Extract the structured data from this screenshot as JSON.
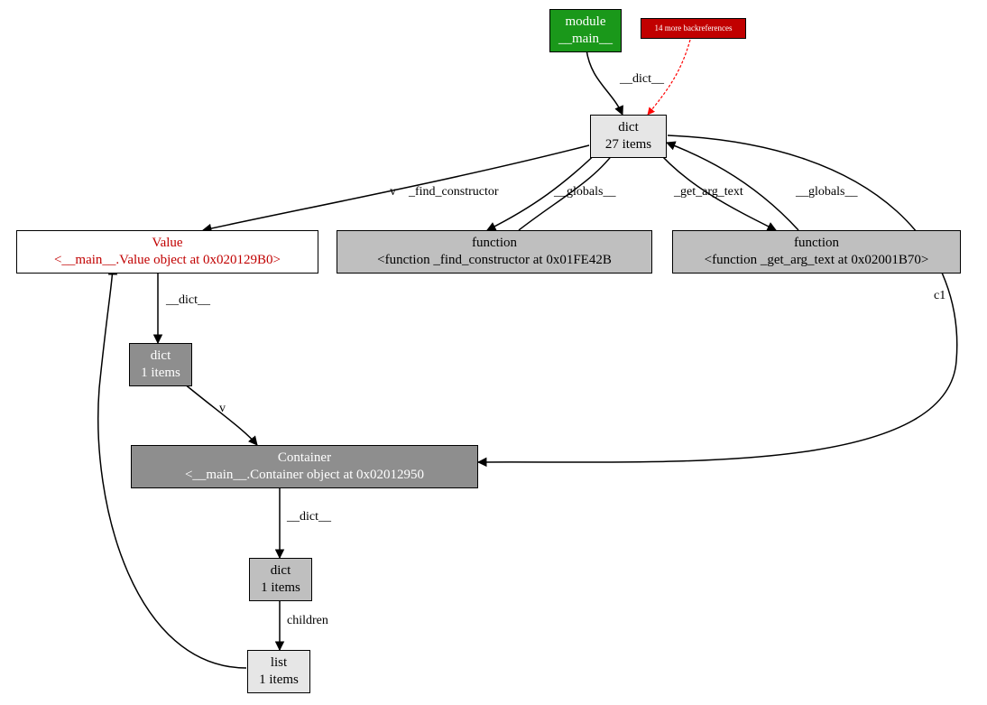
{
  "nodes": {
    "module": {
      "line1": "module",
      "line2": "__main__"
    },
    "backrefs": {
      "line1": "14 more backreferences"
    },
    "dict27": {
      "line1": "dict",
      "line2": "27 items"
    },
    "value": {
      "line1": "Value",
      "line2": "<__main__.Value object at 0x020129B0>"
    },
    "func1": {
      "line1": "function",
      "line2": "<function _find_constructor at 0x01FE42B"
    },
    "func2": {
      "line1": "function",
      "line2": "<function _get_arg_text at 0x02001B70>"
    },
    "dict1a": {
      "line1": "dict",
      "line2": "1 items"
    },
    "container": {
      "line1": "Container",
      "line2": "<__main__.Container object at 0x02012950"
    },
    "dict1b": {
      "line1": "dict",
      "line2": "1 items"
    },
    "list1": {
      "line1": "list",
      "line2": "1 items"
    }
  },
  "edge_labels": {
    "module_dict27": "__dict__",
    "dict27_value": "v",
    "dict27_func1a": "_find_constructor",
    "func1_dict27": "__globals__",
    "dict27_func2a": "_get_arg_text",
    "func2_dict27": "__globals__",
    "dict27_container": "c1",
    "value_dict1a": "__dict__",
    "dict1a_container": "v",
    "container_dict1b": "__dict__",
    "dict1b_list1": "children"
  }
}
